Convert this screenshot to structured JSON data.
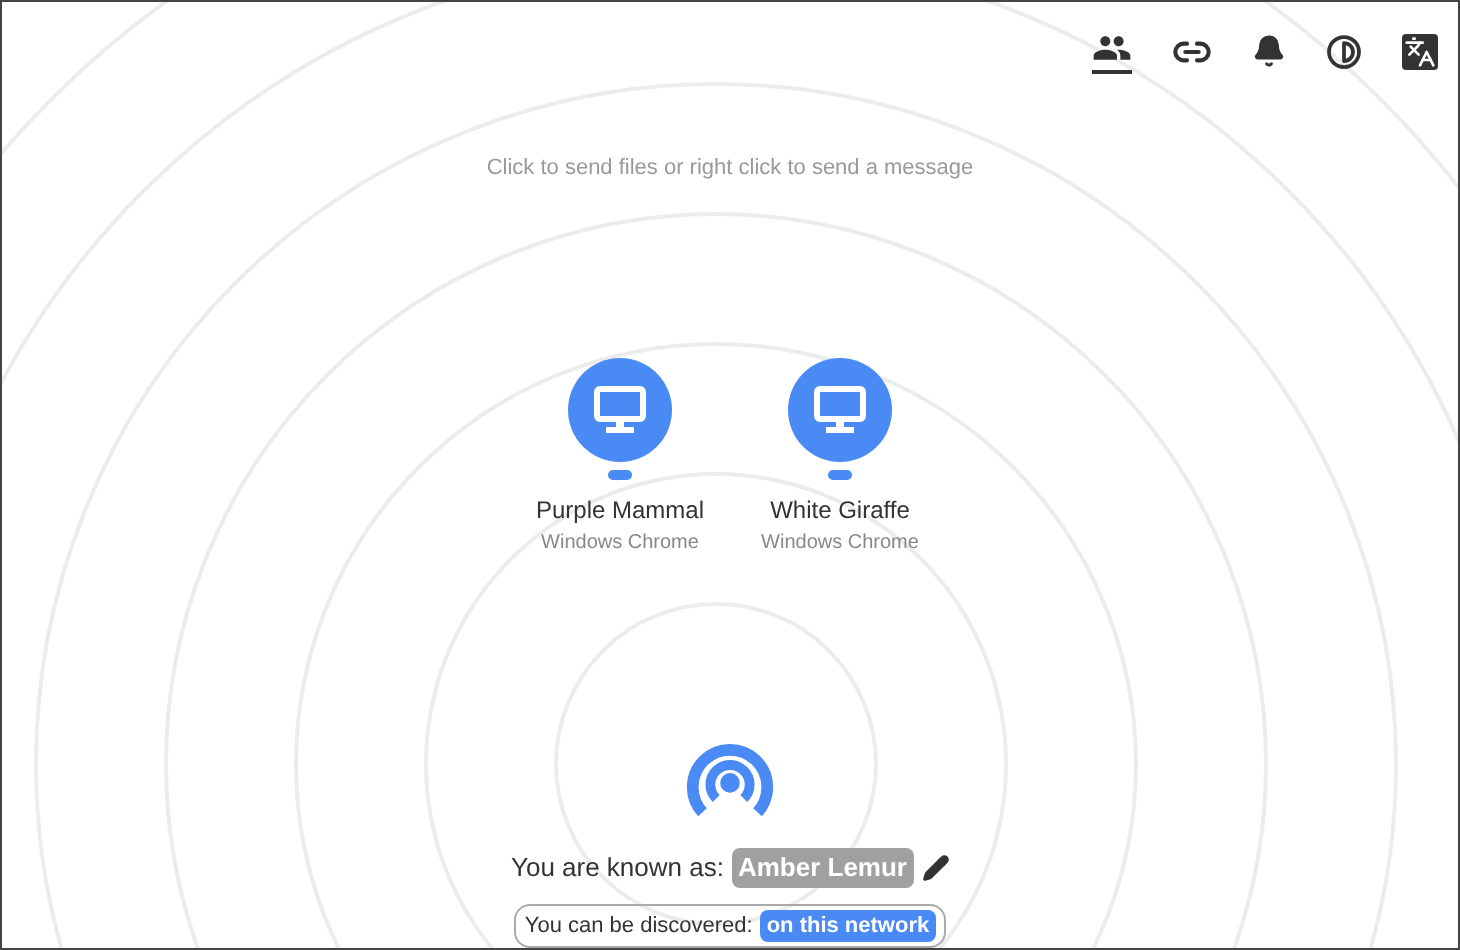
{
  "hint": "Click to send files or right click to send a message",
  "peers": [
    {
      "name": "Purple Mammal",
      "device": "Windows Chrome"
    },
    {
      "name": "White Giraffe",
      "device": "Windows Chrome"
    }
  ],
  "known_as": {
    "label": "You are known as:",
    "name": "Amber Lemur"
  },
  "discoverable": {
    "label": "You can be discovered:",
    "value": "on this network"
  }
}
